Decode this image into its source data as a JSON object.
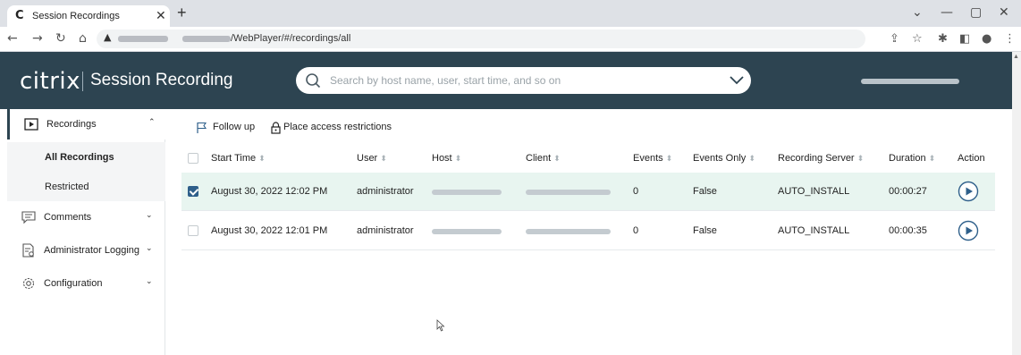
{
  "browser": {
    "tab_title": "Session Recordings",
    "tab_favicon": "C",
    "tab_close": "✕",
    "new_tab": "+",
    "url": "/WebPlayer/#/recordings/all",
    "window_controls": [
      "⌄",
      "—",
      "▢",
      "✕"
    ]
  },
  "header": {
    "brand": "citrix",
    "product": "Session Recording",
    "search_placeholder": "Search by host name, user, start time, and so on"
  },
  "sidebar": {
    "items": [
      {
        "label": "Recordings",
        "chevron": "⌃",
        "icon": "play-square-icon"
      },
      {
        "label": "Comments",
        "chevron": "⌄",
        "icon": "comment-icon"
      },
      {
        "label": "Administrator Logging",
        "chevron": "⌄",
        "icon": "log-document-icon"
      },
      {
        "label": "Configuration",
        "chevron": "⌄",
        "icon": "gear-icon"
      }
    ],
    "subitems": [
      {
        "label": "All Recordings",
        "selected": true
      },
      {
        "label": "Restricted",
        "selected": false
      }
    ]
  },
  "toolbar": {
    "follow_up": "Follow up",
    "place_restrictions": "Place access restrictions"
  },
  "table": {
    "columns": [
      "Start Time",
      "User",
      "Host",
      "Client",
      "Events",
      "Events Only",
      "Recording Server",
      "Duration",
      "Action"
    ],
    "rows": [
      {
        "start_time": "August 30, 2022 12:02 PM",
        "user": "administrator",
        "events": "0",
        "events_only": "False",
        "recording_server": "AUTO_INSTALL",
        "duration": "00:00:27",
        "selected": true
      },
      {
        "start_time": "August 30, 2022 12:01 PM",
        "user": "administrator",
        "events": "0",
        "events_only": "False",
        "recording_server": "AUTO_INSTALL",
        "duration": "00:00:35",
        "selected": false
      }
    ]
  },
  "colors": {
    "header_bg": "#2d4451",
    "selected_row_bg": "#e8f5f0",
    "checkbox_checked": "#2e5f8a",
    "play_icon": "#2e5f8a"
  }
}
